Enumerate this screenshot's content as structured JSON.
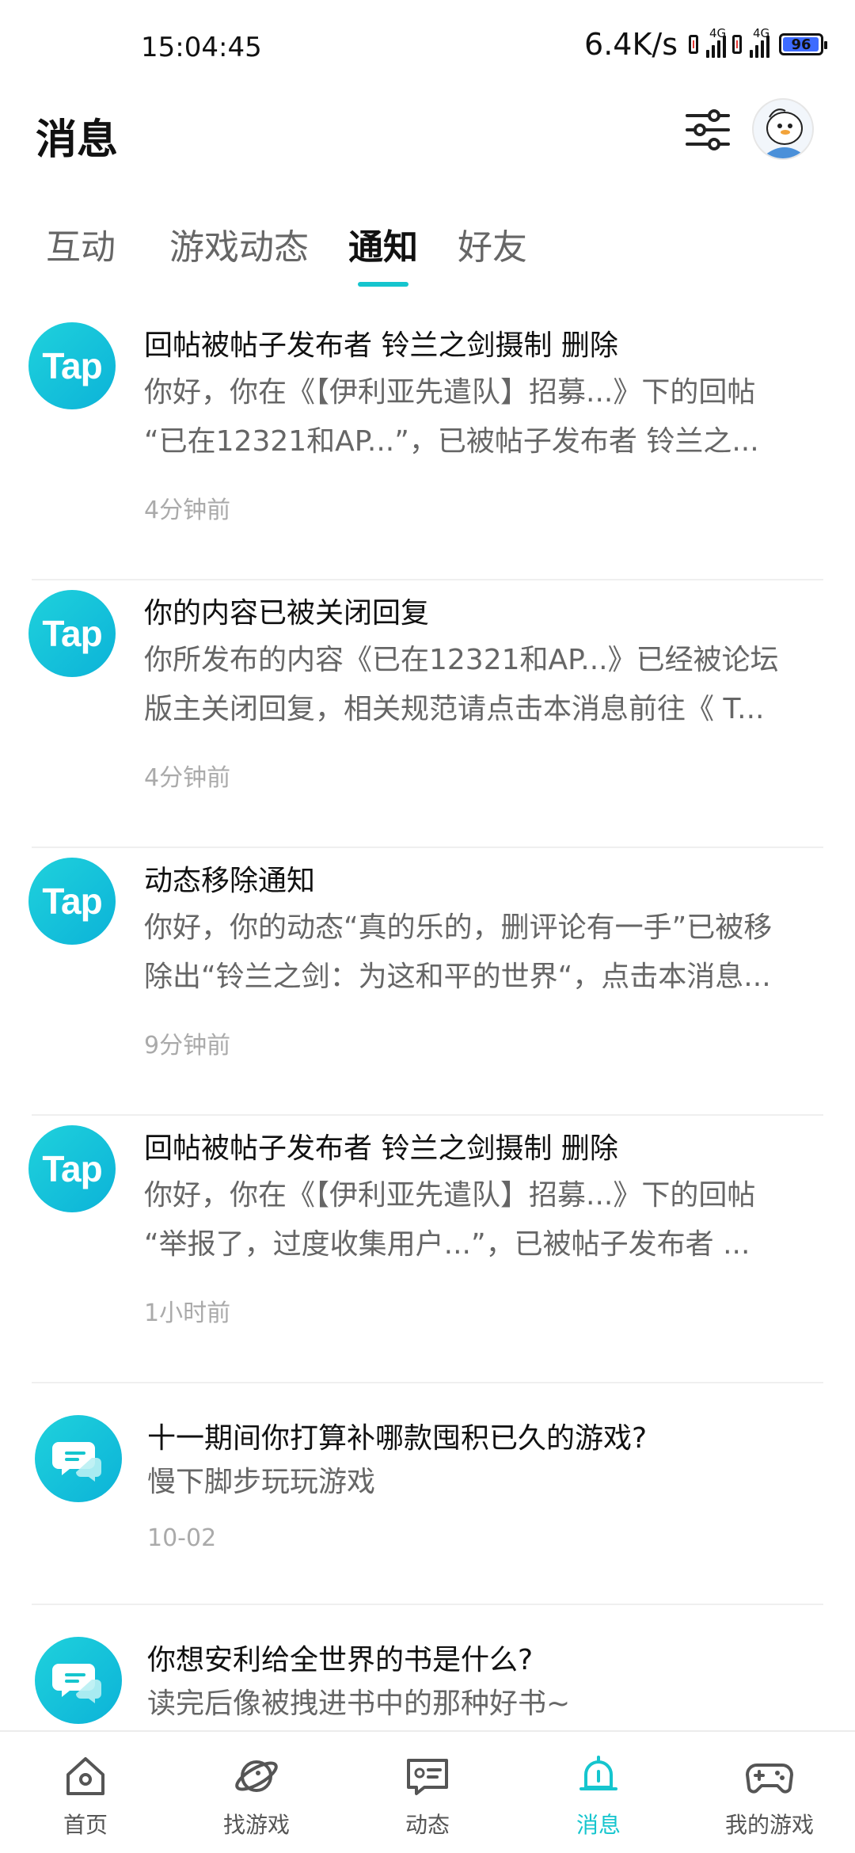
{
  "status_bar": {
    "time": "15:04:45",
    "net_speed": "6.4K/s",
    "signal_1": "4G",
    "signal_2": "4G",
    "battery": "96"
  },
  "header": {
    "title": "消息",
    "filter_icon": "sliders-icon",
    "avatar": "avatar"
  },
  "tabs": [
    {
      "label": "互动",
      "active": false
    },
    {
      "label": "游戏动态",
      "active": false
    },
    {
      "label": "通知",
      "active": true
    },
    {
      "label": "好友",
      "active": false
    }
  ],
  "notifications": [
    {
      "logo": "Tap",
      "title": "回帖被帖子发布者 铃兰之剑摄制 删除",
      "line1": "你好，你在《【伊利亚先遣队】招募...》下的回帖",
      "line2": "“已在12321和AP...”，已被帖子发布者 铃兰之...",
      "time": "4分钟前"
    },
    {
      "logo": "Tap",
      "title": "你的内容已被关闭回复",
      "line1": "你所发布的内容《已在12321和AP...》已经被论坛",
      "line2": "版主关闭回复，相关规范请点击本消息前往《 T...",
      "time": "4分钟前"
    },
    {
      "logo": "Tap",
      "title": "动态移除通知",
      "line1": "你好，你的动态“真的乐的，删评论有一手”已被移",
      "line2": "除出“铃兰之剑：为这和平的世界“，点击本消息...",
      "time": "9分钟前"
    },
    {
      "logo": "Tap",
      "title": "回帖被帖子发布者 铃兰之剑摄制 删除",
      "line1": "你好，你在《【伊利亚先遣队】招募...》下的回帖",
      "line2": "“举报了，过度收集用户...”，已被帖子发布者 ...",
      "time": "1小时前"
    }
  ],
  "topics": [
    {
      "title": "十一期间你打算补哪款囤积已久的游戏?",
      "subtitle": "慢下脚步玩玩游戏",
      "time": "10-02"
    },
    {
      "title": "你想安利给全世界的书是什么?",
      "subtitle": "读完后像被拽进书中的那种好书~",
      "time": ""
    }
  ],
  "bottom_nav": [
    {
      "label": "首页",
      "icon": "home-icon",
      "active": false
    },
    {
      "label": "找游戏",
      "icon": "planet-icon",
      "active": false
    },
    {
      "label": "动态",
      "icon": "feed-icon",
      "active": false
    },
    {
      "label": "消息",
      "icon": "bell-icon",
      "active": true
    },
    {
      "label": "我的游戏",
      "icon": "gamepad-icon",
      "active": false
    }
  ],
  "colors": {
    "accent": "#15c5ce",
    "text_primary": "#111111",
    "text_secondary": "#666666",
    "text_muted": "#aaaaaa"
  }
}
